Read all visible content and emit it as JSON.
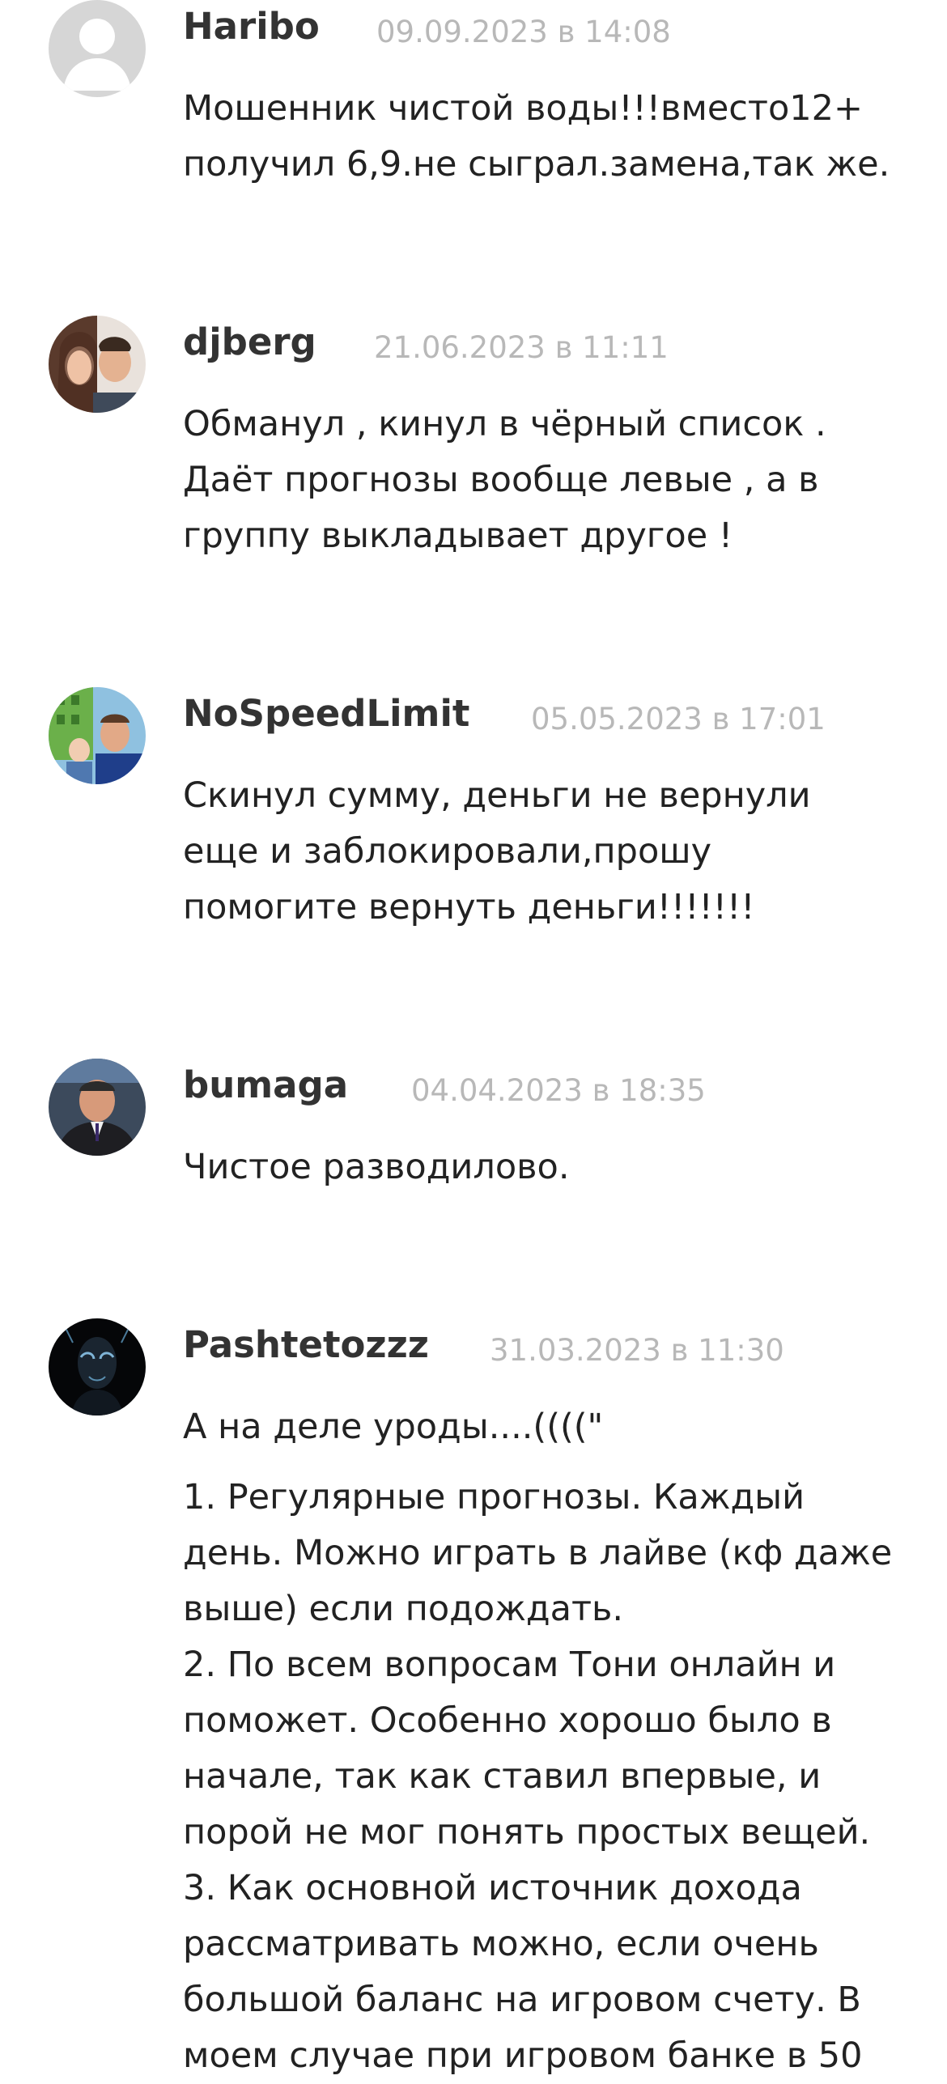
{
  "comments": [
    {
      "author": "Haribo",
      "date": "09.09.2023 в 14:08",
      "avatar_icon": "default-user-icon",
      "lines": [
        "Мошенник чистой воды!!!вместо12+",
        "получил 6,9.не сыграл.замена,так же."
      ]
    },
    {
      "author": "djberg",
      "date": "21.06.2023 в 11:11",
      "avatar_icon": "couple-photo-avatar",
      "lines": [
        "Обманул , кинул в чёрный список .",
        "Даёт прогнозы вообще левые , а в",
        "группу выкладывает другое !"
      ]
    },
    {
      "author": "NoSpeedLimit",
      "date": "05.05.2023 в 17:01",
      "avatar_icon": "family-photo-avatar",
      "lines": [
        "Скинул сумму, деньги не вернули",
        "еще и заблокировали,прошу",
        "помогите вернуть деньги!!!!!!!"
      ]
    },
    {
      "author": "bumaga",
      "date": "04.04.2023 в 18:35",
      "avatar_icon": "man-photo-avatar",
      "lines": [
        "Чистое разводилово."
      ]
    },
    {
      "author": "Pashtetozzz",
      "date": "31.03.2023 в 11:30",
      "avatar_icon": "dark-mask-avatar",
      "intro": "А на деле уроды....((((\"",
      "lines": [
        "1. Регулярные прогнозы. Каждый",
        "день. Можно играть в лайве (кф даже",
        "выше) если подождать.",
        "2. По всем вопросам Тони онлайн и",
        "поможет. Особенно хорошо было в",
        "начале, так как ставил впервые, и",
        "порой не мог понять простых вещей.",
        "3. Как основной источник дохода",
        "рассматривать можно, если очень",
        "большой баланс на игровом счету. В",
        "моем случае при игровом банке в 50"
      ]
    }
  ]
}
